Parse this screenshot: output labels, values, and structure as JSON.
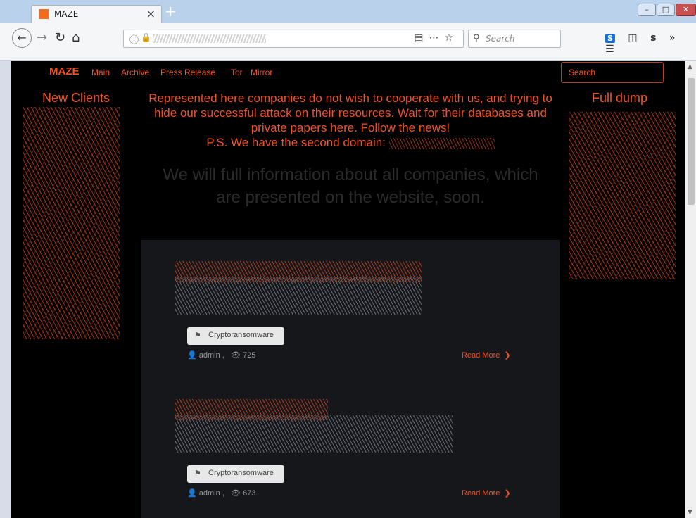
{
  "browser": {
    "tab_title": "MAZE",
    "tab_close": "×",
    "new_tab": "+",
    "search_placeholder": "Search",
    "window_min": "–",
    "window_max": "□",
    "window_close": "✕"
  },
  "site": {
    "logo": "MAZE",
    "nav": [
      "Main",
      "Archive",
      "Press Release",
      "Tor",
      "Mirror"
    ],
    "search_label": "Search",
    "left_heading": "New Clients",
    "right_heading": "Full dump",
    "notice": "Represented here companies do not wish to cooperate with us, and trying to hide our successful attack on their resources. Wait for their databases and private papers here. Follow the news!",
    "notice_ps": "P.S. We have the second domain:",
    "coming_soon": "We will full information about all companies, which are presented on the website, soon."
  },
  "posts": [
    {
      "tag": "Cryptoransomware",
      "author": "admin",
      "views": "725",
      "read_more": "Read More"
    },
    {
      "tag": "Cryptoransomware",
      "author": "admin",
      "views": "673",
      "read_more": "Read More"
    }
  ],
  "colors": {
    "accent": "#f4511e",
    "background": "#000000",
    "panel": "#15171b"
  }
}
